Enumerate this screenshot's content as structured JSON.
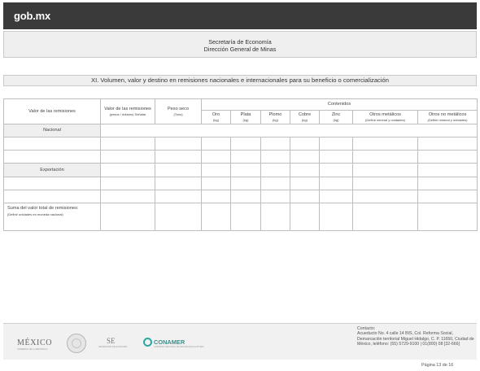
{
  "brand": {
    "logo_text": "gob.mx"
  },
  "header": {
    "line1": "Secretaría de Economía",
    "line2": "Dirección General de Minas"
  },
  "section": {
    "title": "XI. Volumen, valor y destino en remisiones nacionales e internacionales para su beneficio o comercialización"
  },
  "table": {
    "col_valor_remisiones": "Valor de las remisiones",
    "col_valor": "Valor de las remisiones",
    "col_valor_unit": "(pesos / dólares) Señalar",
    "col_peso": "Peso seco",
    "col_peso_unit": "(Tons)",
    "col_contenidos": "Contenidos",
    "sub_oro": "Oro",
    "sub_oro_unit": "(kg)",
    "sub_plata": "Plata",
    "sub_plata_unit": "(kg)",
    "sub_plomo": "Plomo",
    "sub_plomo_unit": "(kg)",
    "sub_cobre": "Cobre",
    "sub_cobre_unit": "(kg)",
    "sub_zinc": "Zinc",
    "sub_zinc_unit": "(kg)",
    "sub_otros_met": "Otros metálicos",
    "sub_otros_met_unit": "(Definir mineral y unidades)",
    "sub_otros_nomet": "Otros no metálicos",
    "sub_otros_nomet_unit": "(Definir mineral y unidades)",
    "row_nacional": "Nacional",
    "row_exportacion": "Exportación",
    "row_suma": "Suma del valor total de remisiones:",
    "row_suma_note": "(Definir unidades en moneda nacional)"
  },
  "footer": {
    "mexico": "MÉXICO",
    "mexico_sub": "GOBIERNO DE LA REPÚBLICA",
    "se": "SE",
    "se_sub": "SECRETARÍA DE ECONOMÍA",
    "conamer": "CONAMER",
    "conamer_sub": "COMISIÓN NACIONAL DE MEJORA REGULATORIA",
    "contact_label": "Contacto:",
    "contact_text": "Acueducto No. 4 calle 14 BIS, Col. Reforma Social, Demarcación territorial Miguel Hidalgo, C. P. 11650, Ciudad de México, teléfono: (55) 5729-9100 | 01(800) 08 [32-666]"
  },
  "page": {
    "label": "Página 13 de 16"
  }
}
